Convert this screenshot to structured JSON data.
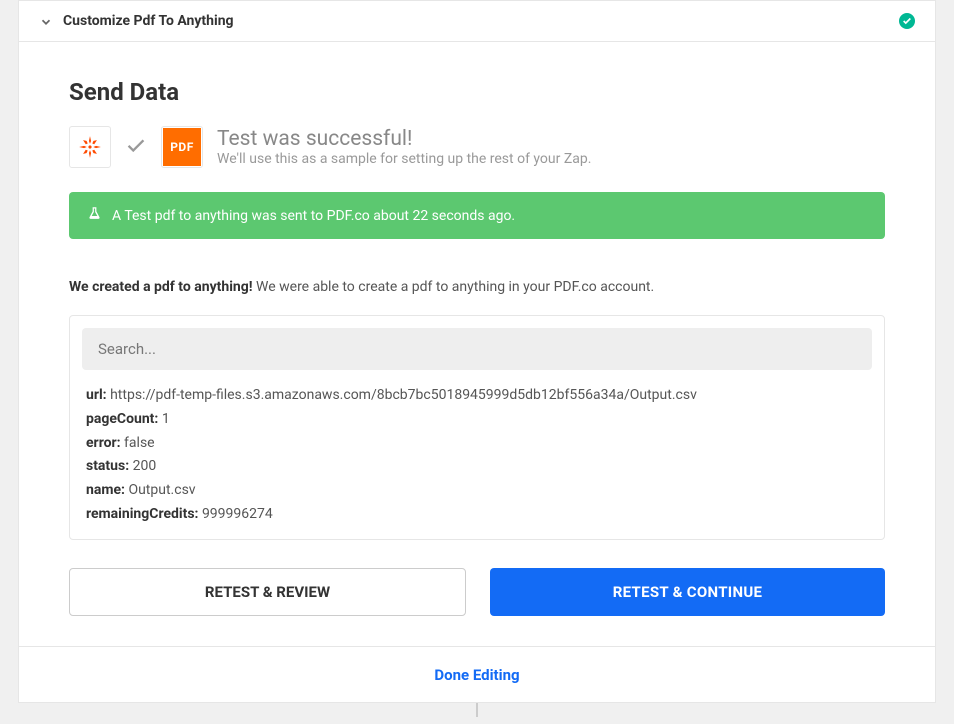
{
  "header": {
    "title": "Customize Pdf To Anything"
  },
  "section": {
    "title": "Send Data",
    "test_result_title": "Test was successful!",
    "test_result_sub": "We'll use this as a sample for setting up the rest of your Zap.",
    "banner_text": "A Test pdf to anything was sent to PDF.co about 22 seconds ago.",
    "created_bold": "We created a pdf to anything!",
    "created_text": " We were able to create a pdf to anything in your PDF.co account.",
    "search_placeholder": "Search...",
    "pdf_icon_label": "PDF"
  },
  "data_fields": {
    "url": {
      "key": "url:",
      "value": " https://pdf-temp-files.s3.amazonaws.com/8bcb7bc5018945999d5db12bf556a34a/Output.csv"
    },
    "pageCount": {
      "key": "pageCount:",
      "value": " 1"
    },
    "error": {
      "key": "error:",
      "value": " false"
    },
    "status": {
      "key": "status:",
      "value": " 200"
    },
    "name": {
      "key": "name:",
      "value": " Output.csv"
    },
    "remainingCredits": {
      "key": "remainingCredits:",
      "value": " 999996274"
    }
  },
  "buttons": {
    "retest_review": "RETEST & REVIEW",
    "retest_continue": "RETEST & CONTINUE",
    "done": "Done Editing"
  }
}
